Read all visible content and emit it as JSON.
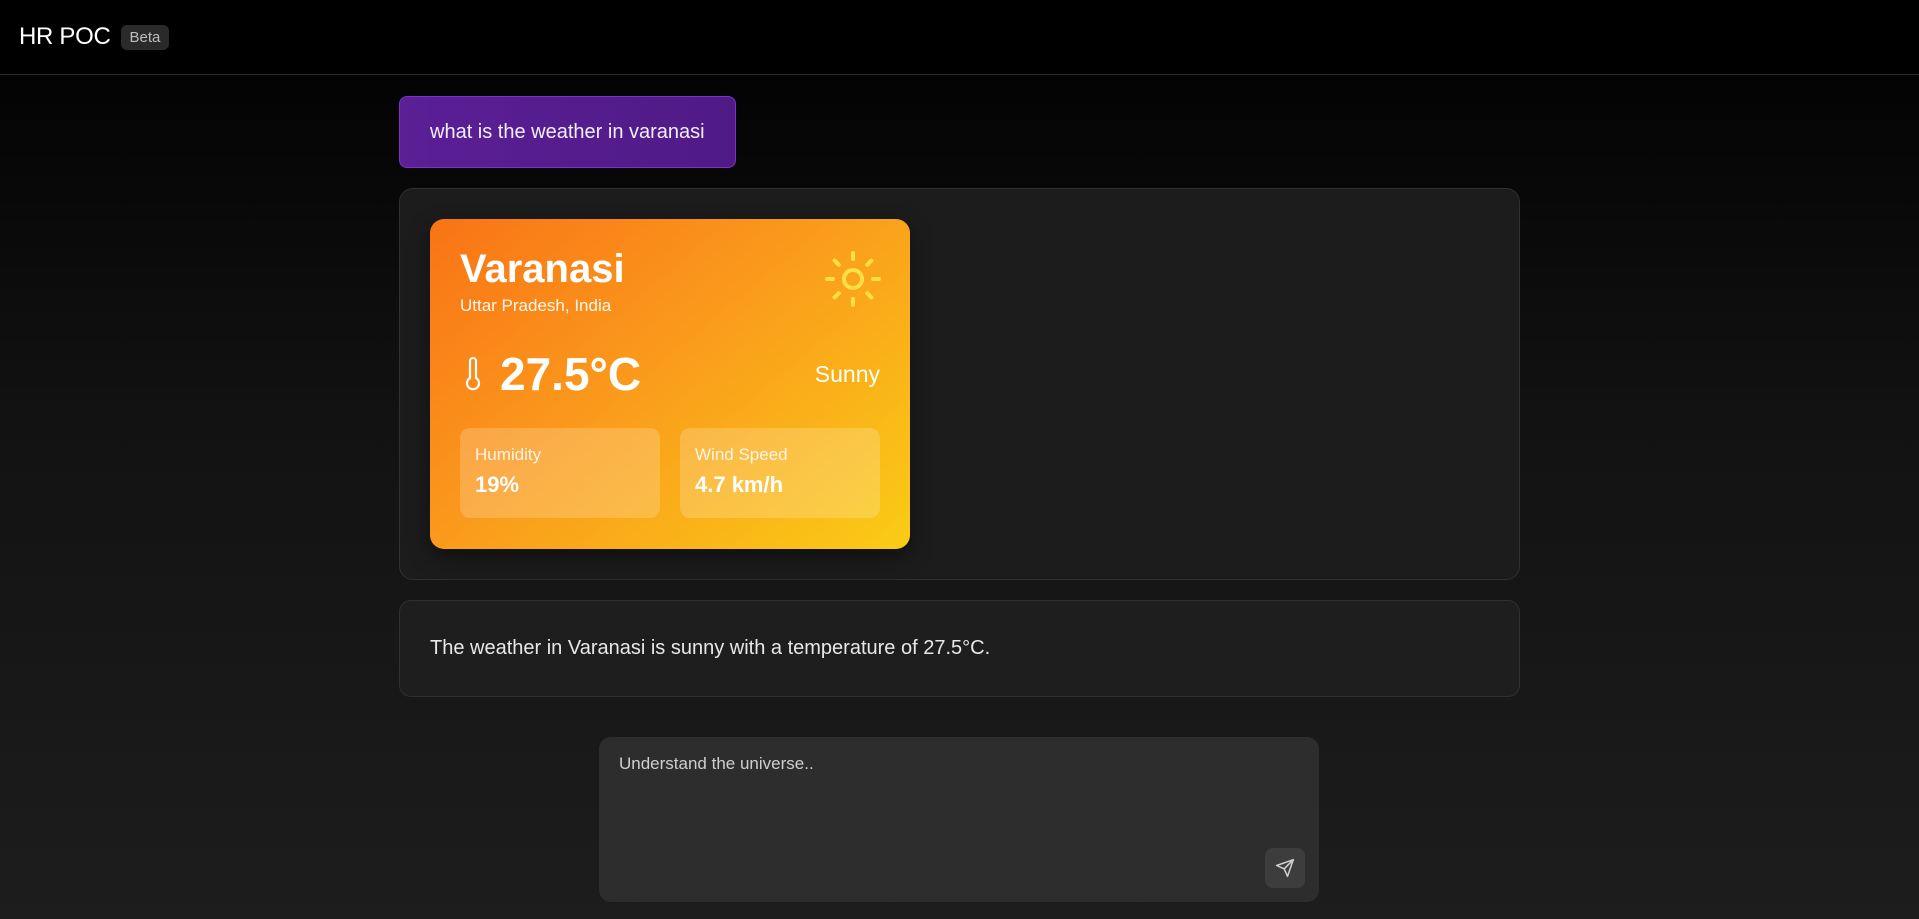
{
  "header": {
    "title": "HR POC",
    "badge": "Beta"
  },
  "conversation": {
    "user_message": "what is the weather in varanasi",
    "weather_card": {
      "city": "Varanasi",
      "region": "Uttar Pradesh, India",
      "temperature": "27.5°C",
      "condition": "Sunny",
      "condition_icon": "sun-icon",
      "temperature_icon": "thermometer-icon",
      "humidity_label": "Humidity",
      "humidity_value": "19%",
      "wind_label": "Wind Speed",
      "wind_value": "4.7 km/h",
      "gradient_colors": [
        "#f97316",
        "#facc15"
      ]
    },
    "assistant_reply": "The weather in Varanasi is sunny with a temperature of 27.5°C."
  },
  "composer": {
    "placeholder": "Understand the universe..",
    "value": "",
    "send_icon": "send-icon"
  },
  "colors": {
    "user_bubble": "#5b1f96",
    "background": "#000000",
    "card": "#1c1c1c",
    "composer": "#2d2d2d"
  }
}
